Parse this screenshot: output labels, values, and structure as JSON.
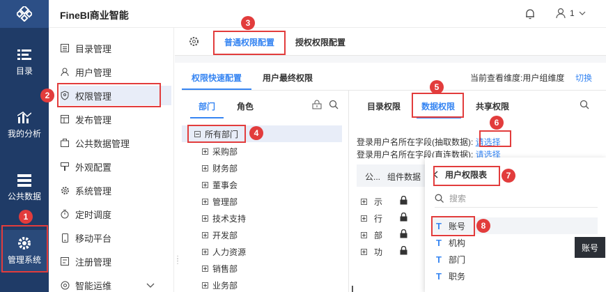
{
  "app": {
    "brand": "FineBI商业智能",
    "user": "1"
  },
  "leftnav": [
    {
      "label": "目录",
      "icon": "catalog-icon"
    },
    {
      "label": "我的分析",
      "icon": "chart-icon"
    },
    {
      "label": "公共数据",
      "icon": "database-icon"
    },
    {
      "label": "管理系统",
      "icon": "gear-icon",
      "active": true
    }
  ],
  "submenu": [
    {
      "label": "目录管理",
      "icon": "list-icon"
    },
    {
      "label": "用户管理",
      "icon": "user-icon"
    },
    {
      "label": "权限管理",
      "icon": "shield-icon",
      "active": true
    },
    {
      "label": "发布管理",
      "icon": "publish-icon"
    },
    {
      "label": "公共数据管理",
      "icon": "folder-icon"
    },
    {
      "label": "外观配置",
      "icon": "brush-icon"
    },
    {
      "label": "系统管理",
      "icon": "settings-icon"
    },
    {
      "label": "定时调度",
      "icon": "timer-icon"
    },
    {
      "label": "移动平台",
      "icon": "mobile-icon"
    },
    {
      "label": "注册管理",
      "icon": "register-icon"
    },
    {
      "label": "智能运维",
      "icon": "ops-icon"
    }
  ],
  "tabs": {
    "normal": "普通权限配置",
    "grant": "授权权限配置"
  },
  "subtabs": {
    "quick": "权限快速配置",
    "final": "用户最终权限",
    "dimension": "当前查看维度:用户组维度",
    "switch": "切换"
  },
  "tree": {
    "tab_dept": "部门",
    "tab_role": "角色",
    "root": "所有部门",
    "children": [
      "采购部",
      "财务部",
      "董事会",
      "管理部",
      "技术支持",
      "开发部",
      "人力资源",
      "销售部",
      "业务部"
    ]
  },
  "right": {
    "tabs": [
      "目录权限",
      "数据权限",
      "共享权限"
    ],
    "line1_label": "登录用户名所在字段(抽取数据):",
    "line1_link": "请选择",
    "line2_label": "登录用户名所在字段(直连数据):",
    "line2_link": "请选择",
    "grid_head": [
      "公...",
      "组件数据"
    ],
    "rows": [
      "示",
      "行",
      "部",
      "功"
    ]
  },
  "popup": {
    "title": "用户权限表",
    "search_placeholder": "搜索",
    "fields": [
      "账号",
      "机构",
      "部门",
      "职务"
    ]
  },
  "tooltip": "账号",
  "badges": [
    "1",
    "2",
    "3",
    "4",
    "5",
    "6",
    "7",
    "8"
  ],
  "colors": {
    "accent": "#3685f2",
    "nav": "#1f3b67",
    "annotation": "#e23c3c"
  }
}
